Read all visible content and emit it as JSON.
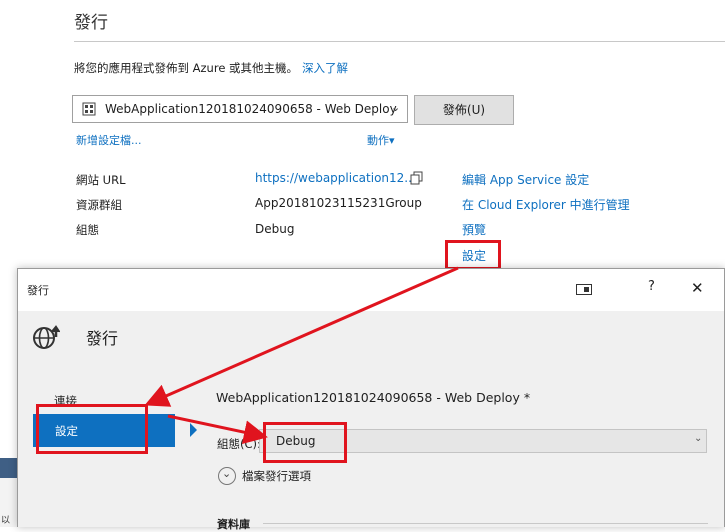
{
  "publish_page": {
    "title": "發行",
    "description": "將您的應用程式發佈到 Azure 或其他主機。",
    "learn_more": "深入了解",
    "profile_select_value": "WebApplication120181024090658 - Web Deploy",
    "publish_button": "發佈(U)",
    "new_profile_link": "新增設定檔...",
    "actions_link": "動作▾",
    "properties": [
      {
        "label": "網站 URL",
        "value": "https://webapplication12..."
      },
      {
        "label": "資源群組",
        "value": "App20181023115231Group"
      },
      {
        "label": "組態",
        "value": "Debug"
      }
    ],
    "links": {
      "edit_app_service": "編輯 App Service 設定",
      "cloud_explorer": "在 Cloud Explorer 中進行管理",
      "preview": "預覽",
      "settings": "設定"
    }
  },
  "dialog": {
    "title": "發行",
    "help": "?",
    "close": "✕",
    "header_title": "發行",
    "nav": {
      "connect": "連接",
      "settings": "設定"
    },
    "profile_heading": "WebApplication120181024090658 - Web Deploy *",
    "configuration_label": "組態(C):",
    "configuration_value": "Debug",
    "file_publish_options": "檔案發行選項",
    "database_label": "資料庫"
  },
  "edge_text": "以",
  "colors": {
    "link": "#0e70c0",
    "highlight_red": "#e0141e",
    "nav_selected": "#0e70c0",
    "dialog_bg": "#f0f0f0"
  }
}
